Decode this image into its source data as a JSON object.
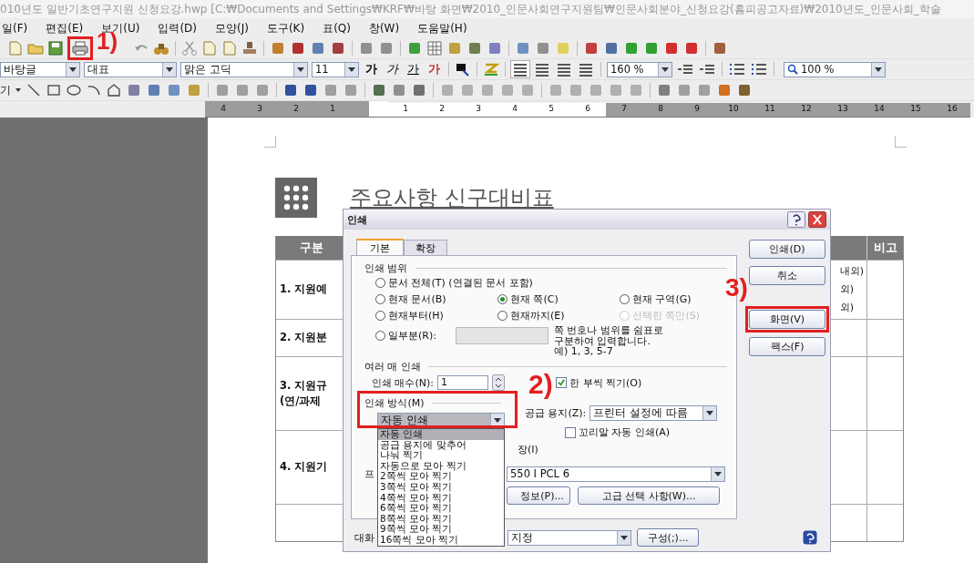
{
  "window": {
    "title": "010년도 일반기초연구지원 신청요강.hwp [C:₩Documents and Settings₩KRF₩바탕 화면₩2010_인문사회연구지원팀₩인문사회분야_신청요강(홈피공고자료)₩2010년도_인문사회_학술"
  },
  "menu": [
    "일(F)",
    "편집(E)",
    "보기(U)",
    "입력(D)",
    "모양(J)",
    "도구(K)",
    "표(Q)",
    "창(W)",
    "도움말(H)"
  ],
  "toolbar": {
    "annotation": "1)"
  },
  "format_bar": {
    "style": "바탕글",
    "outline": "대표",
    "font": "맑은 고딕",
    "size": "11",
    "char_buttons": [
      {
        "label": "가",
        "kind": "bold"
      },
      {
        "label": "가",
        "kind": "italic"
      },
      {
        "label": "가",
        "kind": "underline"
      },
      {
        "label": "가",
        "kind": "color"
      }
    ],
    "line_spacing": "160 %",
    "zoom": "100 %"
  },
  "draw_bar": {
    "label": "기"
  },
  "ruler": {
    "left_ticks": [
      "4",
      "3",
      "2",
      "1"
    ],
    "ticks": [
      {
        "label": "1",
        "margin": false
      },
      {
        "label": "2",
        "margin": false
      },
      {
        "label": "3",
        "margin": false
      },
      {
        "label": "4",
        "margin": false
      },
      {
        "label": "5",
        "margin": false
      },
      {
        "label": "6",
        "margin": false
      },
      {
        "label": "7",
        "margin": true
      },
      {
        "label": "8",
        "margin": true
      },
      {
        "label": "9",
        "margin": true
      },
      {
        "label": "10",
        "margin": true
      },
      {
        "label": "11",
        "margin": true
      },
      {
        "label": "12",
        "margin": true
      },
      {
        "label": "13",
        "margin": true
      },
      {
        "label": "14",
        "margin": true
      },
      {
        "label": "15",
        "margin": true
      },
      {
        "label": "16",
        "margin": true
      }
    ]
  },
  "document": {
    "heading": "주요사항 신구대비표",
    "table": {
      "header": [
        "구분",
        "비고"
      ],
      "rows": [
        {
          "first": "1. 지원예",
          "second": "내외)\n외)\n외)"
        },
        {
          "first": "2. 지원분"
        },
        {
          "first": "3. 지원규\n(연/과제"
        },
        {
          "first": "4. 지원기"
        }
      ]
    }
  },
  "dialog": {
    "title": "인쇄",
    "tabs": [
      {
        "label": "기본",
        "selected": true
      },
      {
        "label": "확장",
        "selected": false
      }
    ],
    "range": {
      "label": "인쇄 범위",
      "rows": [
        [
          {
            "label": "문서 전체(T) (연결된 문서 포함)",
            "selected": false,
            "disabled": false
          }
        ],
        [
          {
            "label": "현재 문서(B)",
            "selected": false,
            "disabled": false
          },
          {
            "label": "현재 쪽(C)",
            "selected": true,
            "disabled": false
          },
          {
            "label": "현재 구역(G)",
            "selected": false,
            "disabled": false
          }
        ],
        [
          {
            "label": "현재부터(H)",
            "selected": false,
            "disabled": false
          },
          {
            "label": "현재까지(E)",
            "selected": false,
            "disabled": false
          },
          {
            "label": "선택한 쪽만(S)",
            "selected": false,
            "disabled": true
          }
        ]
      ],
      "partial": {
        "label": "일부분(R):",
        "selected": false
      },
      "hint": "쪽 번호나 범위를 쉼표로\n구분하여 입력합니다.\n예) 1, 3, 5-7"
    },
    "copies": {
      "label": "여러 매 인쇄",
      "count_label": "인쇄 매수(N):",
      "count": "1",
      "collate": {
        "label": "한 부씩 찍기(O)",
        "checked": true
      }
    },
    "method": {
      "label": "인쇄 방식(M)",
      "value": "자동 인쇄",
      "expanded": true,
      "annotation": "2)",
      "options": [
        {
          "label": "자동 인쇄",
          "selected": true
        },
        {
          "label": "공급 용지에 맞추어",
          "selected": false
        },
        {
          "label": "나눠 찍기",
          "selected": false
        },
        {
          "label": "자동으로 모아 찍기",
          "selected": false
        },
        {
          "label": "2쪽씩 모아 찍기",
          "selected": false
        },
        {
          "label": "3쪽씩 모아 찍기",
          "selected": false
        },
        {
          "label": "4쪽씩 모아 찍기",
          "selected": false
        },
        {
          "label": "6쪽씩 모아 찍기",
          "selected": false
        },
        {
          "label": "8쪽씩 모아 찍기",
          "selected": false
        },
        {
          "label": "9쪽씩 모아 찍기",
          "selected": false
        },
        {
          "label": "16쪽씩 모아 찍기",
          "selected": false
        }
      ]
    },
    "paper": {
      "label": "공급 용지(Z):",
      "value": "프린터 설정에 따름"
    },
    "footnote": {
      "label": "꼬리말 자동 인쇄(A)",
      "checked": false
    },
    "fragment": "장(I)",
    "printer": {
      "label": "프",
      "value": "550 I PCL 6",
      "info_button": "정보(P)...",
      "advanced_button": "고급 선택 사항(W)..."
    },
    "dialog_settings": {
      "label": "대화",
      "value": "지정",
      "config_button": "구성(;)..."
    },
    "buttons": [
      {
        "label": "인쇄(D)"
      },
      {
        "label": "취소"
      },
      {
        "label": "화면(V)",
        "annotation": "3)"
      },
      {
        "label": "팩스(F)"
      }
    ]
  }
}
